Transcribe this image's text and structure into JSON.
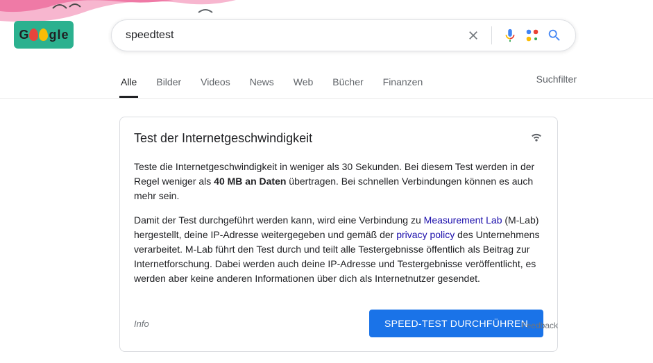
{
  "search": {
    "value": "speedtest",
    "placeholder": ""
  },
  "tabs": {
    "items": [
      "Alle",
      "Bilder",
      "Videos",
      "News",
      "Web",
      "Bücher",
      "Finanzen"
    ],
    "active_index": 0,
    "filter_label": "Suchfilter"
  },
  "card": {
    "title": "Test der Internetgeschwindigkeit",
    "p1_a": "Teste die Internetgeschwindigkeit in weniger als 30 Sekunden. Bei diesem Test werden in der Regel weniger als ",
    "p1_bold": "40 MB an Daten",
    "p1_b": " übertragen. Bei schnellen Verbindungen können es auch mehr sein.",
    "p2_a": "Damit der Test durchgeführt werden kann, wird eine Verbindung zu ",
    "p2_link1": "Measurement Lab",
    "p2_b": " (M-Lab) hergestellt, deine IP-Adresse weitergegeben und gemäß der ",
    "p2_link2": "privacy policy",
    "p2_c": " des Unternehmens verarbeitet. M-Lab führt den Test durch und teilt alle Testergebnisse öffentlich als Beitrag zur Internetforschung. Dabei werden auch deine IP-Adresse und Testergebnisse veröffentlicht, es werden aber keine anderen Informationen über dich als Internetnutzer gesendet.",
    "info_label": "Info",
    "button_label": "SPEED-TEST DURCHFÜHREN"
  },
  "feedback_label": "Feedback"
}
